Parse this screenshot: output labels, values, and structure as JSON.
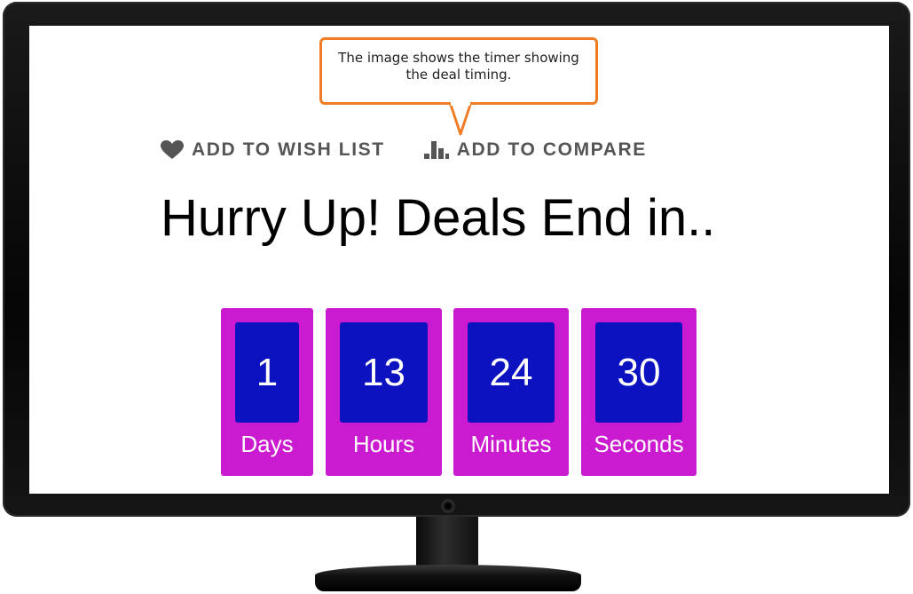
{
  "callout": {
    "text": "The image shows the timer showing the deal timing.",
    "border_color": "#f07d26"
  },
  "actions": {
    "wish_list_label": "ADD TO WISH LIST",
    "wish_list_icon": "heart-icon",
    "compare_label": "ADD TO COMPARE",
    "compare_icon": "bar-chart-icon"
  },
  "headline": "Hurry Up! Deals End in..",
  "countdown": {
    "units": [
      {
        "value": "1",
        "label": "Days"
      },
      {
        "value": "13",
        "label": "Hours"
      },
      {
        "value": "24",
        "label": "Minutes"
      },
      {
        "value": "30",
        "label": "Seconds"
      }
    ],
    "outer_color": "#cb1bd0",
    "inner_color": "#0c12c0"
  }
}
